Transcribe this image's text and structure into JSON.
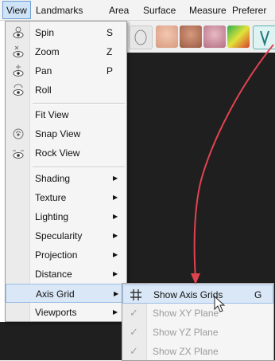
{
  "menubar": {
    "items": [
      {
        "label": "View"
      },
      {
        "label": "Landmarks"
      },
      {
        "label": "Area"
      },
      {
        "label": "Surface"
      },
      {
        "label": "Measure"
      },
      {
        "label": "Preferer"
      }
    ]
  },
  "view_menu": {
    "items": [
      {
        "label": "Spin",
        "shortcut": "S",
        "icon": "spin-eye-icon"
      },
      {
        "label": "Zoom",
        "shortcut": "Z",
        "icon": "zoom-eye-icon"
      },
      {
        "label": "Pan",
        "shortcut": "P",
        "icon": "pan-eye-icon"
      },
      {
        "label": "Roll",
        "shortcut": "",
        "icon": "roll-eye-icon"
      },
      {
        "label": "Fit View",
        "shortcut": "",
        "icon": ""
      },
      {
        "label": "Snap View",
        "shortcut": "",
        "icon": "snap-view-icon"
      },
      {
        "label": "Rock View",
        "shortcut": "",
        "icon": "rock-view-icon"
      },
      {
        "label": "Shading",
        "submenu": true
      },
      {
        "label": "Texture",
        "submenu": true
      },
      {
        "label": "Lighting",
        "submenu": true
      },
      {
        "label": "Specularity",
        "submenu": true
      },
      {
        "label": "Projection",
        "submenu": true
      },
      {
        "label": "Distance",
        "submenu": true
      },
      {
        "label": "Axis Grid",
        "submenu": true,
        "highlighted": true
      },
      {
        "label": "Viewports",
        "submenu": true
      }
    ]
  },
  "axis_grid_submenu": {
    "items": [
      {
        "label": "Show Axis Grids",
        "shortcut": "G",
        "enabled": true,
        "highlighted": true,
        "icon": "grid-icon"
      },
      {
        "label": "Show XY Plane",
        "enabled": false,
        "checked": true
      },
      {
        "label": "Show YZ Plane",
        "enabled": false,
        "checked": true
      },
      {
        "label": "Show ZX Plane",
        "enabled": false,
        "checked": true
      }
    ]
  },
  "glyphs": {
    "submenu_arrow": "▶",
    "check": "✓"
  },
  "colors": {
    "highlight": "#d9e7f7",
    "annotation_arrow": "#e0434f",
    "viewport_bg": "#1f1f1f"
  }
}
